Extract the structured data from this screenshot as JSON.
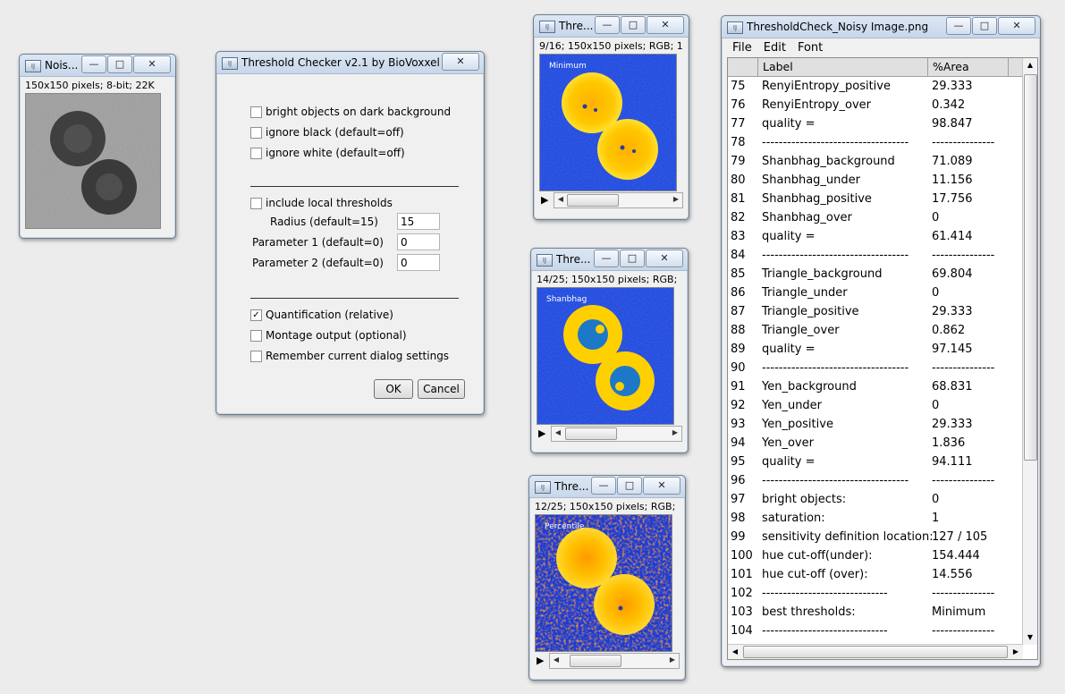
{
  "noisy_window": {
    "title": "Nois...",
    "info": "150x150 pixels; 8-bit; 22K"
  },
  "dialog": {
    "title": "Threshold Checker v2.1 by BioVoxxel",
    "options": [
      {
        "label": "bright objects on dark background",
        "checked": false
      },
      {
        "label": "ignore black (default=off)",
        "checked": false
      },
      {
        "label": "ignore white (default=off)",
        "checked": false
      }
    ],
    "local_thresholds": {
      "label": "include local thresholds",
      "checked": false
    },
    "fields": [
      {
        "label": "Radius (default=15)",
        "value": "15"
      },
      {
        "label": "Parameter 1 (default=0)",
        "value": "0"
      },
      {
        "label": "Parameter 2 (default=0)",
        "value": "0"
      }
    ],
    "output_options": [
      {
        "label": "Quantification (relative)",
        "checked": true
      },
      {
        "label": "Montage output (optional)",
        "checked": false
      },
      {
        "label": "Remember current dialog settings",
        "checked": false
      }
    ],
    "ok_label": "OK",
    "cancel_label": "Cancel"
  },
  "stack_windows": [
    {
      "title": "Thre...",
      "info": "9/16; 150x150 pixels; RGB; 1",
      "overlay": "Minimum"
    },
    {
      "title": "Thre...",
      "info": "14/25; 150x150 pixels; RGB;",
      "overlay": "Shanbhag"
    },
    {
      "title": "Thre...",
      "info": "12/25; 150x150 pixels; RGB;",
      "overlay": "Percentile"
    }
  ],
  "results_window": {
    "title": "ThresholdCheck_Noisy Image.png",
    "menu": [
      "File",
      "Edit",
      "Font"
    ],
    "columns": [
      "",
      "Label",
      "%Area"
    ],
    "rows": [
      [
        "75",
        "RenyiEntropy_positive",
        "29.333"
      ],
      [
        "76",
        "RenyiEntropy_over",
        "0.342"
      ],
      [
        "77",
        "quality =",
        "98.847"
      ],
      [
        "78",
        "-----------------------------------",
        "---------------"
      ],
      [
        "79",
        "Shanbhag_background",
        "71.089"
      ],
      [
        "80",
        "Shanbhag_under",
        "11.156"
      ],
      [
        "81",
        "Shanbhag_positive",
        "17.756"
      ],
      [
        "82",
        "Shanbhag_over",
        "0"
      ],
      [
        "83",
        "quality =",
        "61.414"
      ],
      [
        "84",
        "-----------------------------------",
        "---------------"
      ],
      [
        "85",
        "Triangle_background",
        "69.804"
      ],
      [
        "86",
        "Triangle_under",
        "0"
      ],
      [
        "87",
        "Triangle_positive",
        "29.333"
      ],
      [
        "88",
        "Triangle_over",
        "0.862"
      ],
      [
        "89",
        "quality =",
        "97.145"
      ],
      [
        "90",
        "-----------------------------------",
        "---------------"
      ],
      [
        "91",
        "Yen_background",
        "68.831"
      ],
      [
        "92",
        "Yen_under",
        "0"
      ],
      [
        "93",
        "Yen_positive",
        "29.333"
      ],
      [
        "94",
        "Yen_over",
        "1.836"
      ],
      [
        "95",
        "quality =",
        "94.111"
      ],
      [
        "96",
        "-----------------------------------",
        "---------------"
      ],
      [
        "97",
        "bright objects:",
        "0"
      ],
      [
        "98",
        "saturation:",
        "1"
      ],
      [
        "99",
        "sensitivity definition location:",
        "127 / 105"
      ],
      [
        "100",
        "hue cut-off(under):",
        "154.444"
      ],
      [
        "101",
        "hue cut-off (over):",
        "14.556"
      ],
      [
        "102",
        "------------------------------",
        "---------------"
      ],
      [
        "103",
        "best thresholds:",
        "Minimum"
      ],
      [
        "104",
        "------------------------------",
        "---------------"
      ]
    ]
  },
  "colors": {
    "accent_blue": "#1a3cd6",
    "lut_yellow": "#ffd200",
    "lut_orange": "#f08a10",
    "lut_red": "#e04010"
  }
}
